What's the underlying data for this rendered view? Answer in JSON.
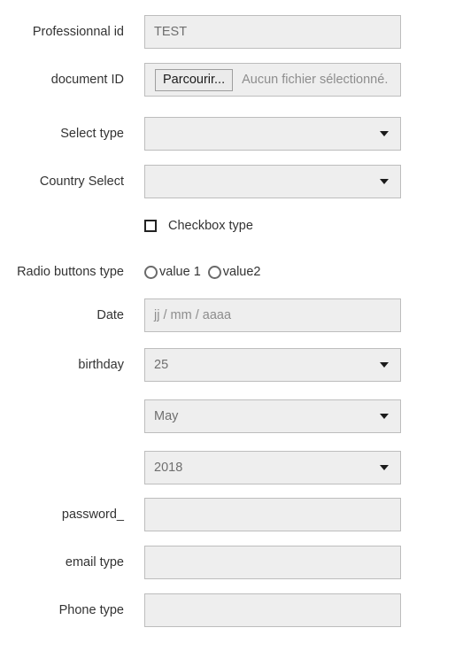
{
  "form": {
    "rows": [
      {
        "label": "Professionnal id",
        "type": "text",
        "value": "TEST",
        "name": "professionnal-id"
      },
      {
        "label": "document ID",
        "type": "file",
        "button_label": "Parcourir...",
        "status_text": "Aucun fichier sélectionné.",
        "name": "document-id"
      },
      {
        "label": "Select type",
        "type": "select",
        "value": "",
        "name": "select-type"
      },
      {
        "label": "Country Select",
        "type": "select",
        "value": "",
        "name": "country-select"
      },
      {
        "label": "",
        "type": "checkbox",
        "checkbox_label": "Checkbox type",
        "checked": false,
        "name": "checkbox-type"
      },
      {
        "label": "Radio buttons type",
        "type": "radio",
        "options": [
          "value 1",
          "value2"
        ],
        "name": "radio-buttons-type"
      },
      {
        "label": "Date",
        "type": "date",
        "placeholder": "jj / mm / aaaa",
        "value": "",
        "name": "date"
      },
      {
        "label": "birthday",
        "type": "select",
        "value": "25",
        "name": "birthday-day"
      },
      {
        "label": "",
        "type": "select",
        "value": "May",
        "name": "birthday-month"
      },
      {
        "label": "",
        "type": "select",
        "value": "2018",
        "name": "birthday-year"
      },
      {
        "label": "password_",
        "type": "password",
        "value": "",
        "name": "password"
      },
      {
        "label": "email type",
        "type": "email",
        "value": "",
        "name": "email-type"
      },
      {
        "label": "Phone type",
        "type": "tel",
        "value": "",
        "name": "phone-type"
      }
    ]
  },
  "colors": {
    "field_background": "#eeeeee",
    "field_border": "#bdbdbd",
    "label_text": "#333333",
    "placeholder_text": "#8d8d8d",
    "value_text": "#6f6f6f",
    "page_background": "#ffffff"
  }
}
